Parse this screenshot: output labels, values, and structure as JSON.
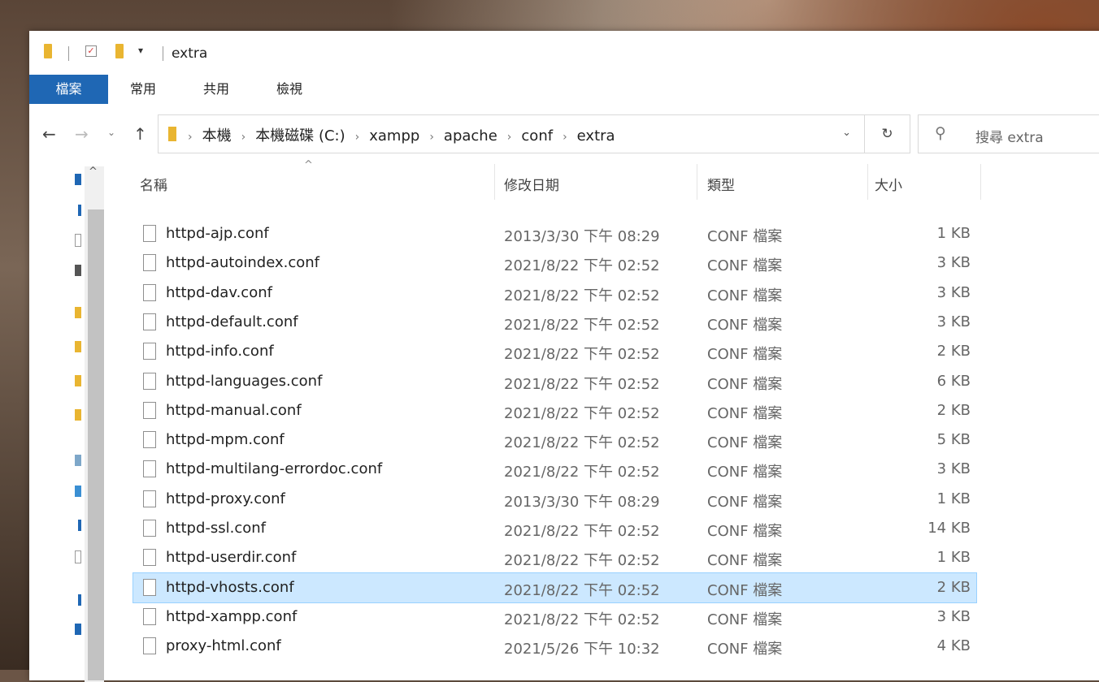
{
  "window": {
    "title": "extra"
  },
  "ribbon": {
    "tabs": [
      "檔案",
      "常用",
      "共用",
      "檢視"
    ]
  },
  "address": {
    "crumbs": [
      "本機",
      "本機磁碟 (C:)",
      "xampp",
      "apache",
      "conf",
      "extra"
    ]
  },
  "search": {
    "placeholder": "搜尋 extra"
  },
  "columns": {
    "name": "名稱",
    "date": "修改日期",
    "type": "類型",
    "size": "大小"
  },
  "files": [
    {
      "name": "httpd-ajp.conf",
      "date": "2013/3/30 下午 08:29",
      "type": "CONF 檔案",
      "size": "1 KB"
    },
    {
      "name": "httpd-autoindex.conf",
      "date": "2021/8/22 下午 02:52",
      "type": "CONF 檔案",
      "size": "3 KB"
    },
    {
      "name": "httpd-dav.conf",
      "date": "2021/8/22 下午 02:52",
      "type": "CONF 檔案",
      "size": "3 KB"
    },
    {
      "name": "httpd-default.conf",
      "date": "2021/8/22 下午 02:52",
      "type": "CONF 檔案",
      "size": "3 KB"
    },
    {
      "name": "httpd-info.conf",
      "date": "2021/8/22 下午 02:52",
      "type": "CONF 檔案",
      "size": "2 KB"
    },
    {
      "name": "httpd-languages.conf",
      "date": "2021/8/22 下午 02:52",
      "type": "CONF 檔案",
      "size": "6 KB"
    },
    {
      "name": "httpd-manual.conf",
      "date": "2021/8/22 下午 02:52",
      "type": "CONF 檔案",
      "size": "2 KB"
    },
    {
      "name": "httpd-mpm.conf",
      "date": "2021/8/22 下午 02:52",
      "type": "CONF 檔案",
      "size": "5 KB"
    },
    {
      "name": "httpd-multilang-errordoc.conf",
      "date": "2021/8/22 下午 02:52",
      "type": "CONF 檔案",
      "size": "3 KB"
    },
    {
      "name": "httpd-proxy.conf",
      "date": "2013/3/30 下午 08:29",
      "type": "CONF 檔案",
      "size": "1 KB"
    },
    {
      "name": "httpd-ssl.conf",
      "date": "2021/8/22 下午 02:52",
      "type": "CONF 檔案",
      "size": "14 KB"
    },
    {
      "name": "httpd-userdir.conf",
      "date": "2021/8/22 下午 02:52",
      "type": "CONF 檔案",
      "size": "1 KB"
    },
    {
      "name": "httpd-vhosts.conf",
      "date": "2021/8/22 下午 02:52",
      "type": "CONF 檔案",
      "size": "2 KB",
      "selected": true
    },
    {
      "name": "httpd-xampp.conf",
      "date": "2021/8/22 下午 02:52",
      "type": "CONF 檔案",
      "size": "3 KB"
    },
    {
      "name": "proxy-html.conf",
      "date": "2021/5/26 下午 10:32",
      "type": "CONF 檔案",
      "size": "4 KB"
    }
  ],
  "colors": {
    "accent": "#1f67b4",
    "selection": "#cce8ff",
    "folder": "#e9b531"
  }
}
